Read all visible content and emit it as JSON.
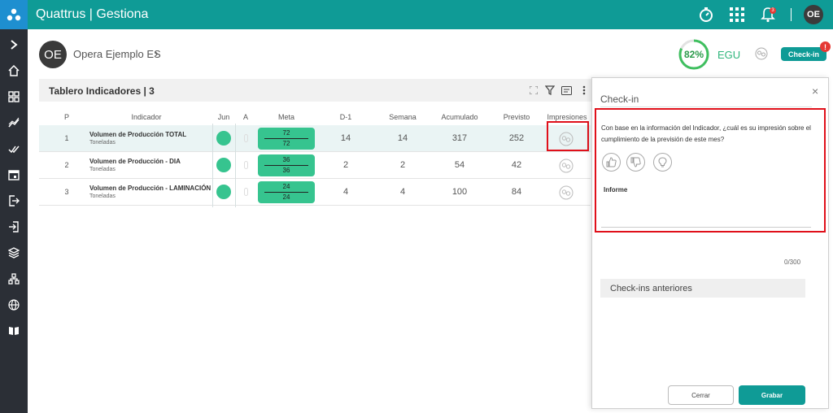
{
  "app": {
    "title": "Quattrus | Gestiona",
    "bell_count": "3",
    "user_initials": "OE"
  },
  "header": {
    "user_initials": "OE",
    "user_name": "Opera Ejemplo ES",
    "progress_label": "82%",
    "progress_value": 0.82,
    "unit_label": "EGU",
    "checkin_label": "Check-in",
    "alert_mark": "!"
  },
  "board": {
    "title": "Tablero Indicadores | 3",
    "columns": [
      "P",
      "Indicador",
      "Jun",
      "A",
      "Meta",
      "D-1",
      "Semana",
      "Acumulado",
      "Previsto",
      "Impresiones"
    ],
    "rows": [
      {
        "p": "1",
        "name": "Volumen de Producción TOTAL",
        "unit": "Toneladas",
        "meta_top": "72",
        "meta_bottom": "72",
        "d1": "14",
        "semana": "14",
        "acumulado": "317",
        "previsto": "252"
      },
      {
        "p": "2",
        "name": "Volumen de Producción - DIA",
        "unit": "Toneladas",
        "meta_top": "36",
        "meta_bottom": "36",
        "d1": "2",
        "semana": "2",
        "acumulado": "54",
        "previsto": "42"
      },
      {
        "p": "3",
        "name": "Volumen de Producción - LAMINACIÓN",
        "unit": "Toneladas",
        "meta_top": "24",
        "meta_bottom": "24",
        "d1": "4",
        "semana": "4",
        "acumulado": "100",
        "previsto": "84"
      }
    ]
  },
  "panel": {
    "close": "×",
    "title": "Check-in",
    "question": "Con base en la información del Indicador, ¿cuál es su impresión sobre el cumplimiento de la previsión de este mes?",
    "informe_label": "Informe",
    "counter": "0/300",
    "previous_label": "Check-ins anteriores",
    "cancel_label": "Cerrar",
    "save_label": "Grabar"
  },
  "colors": {
    "teal": "#0f9b96",
    "green": "#36c48f",
    "sidebar": "#2b2f36",
    "highlight": "#e0101a"
  }
}
